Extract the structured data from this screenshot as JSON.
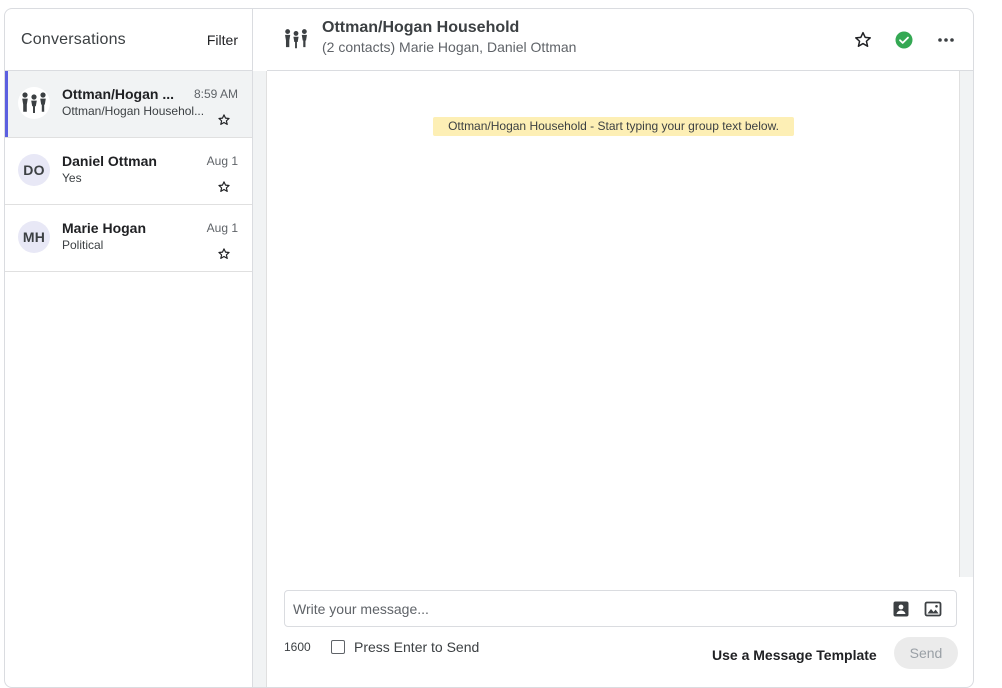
{
  "sidebar": {
    "title": "Conversations",
    "filter_label": "Filter",
    "conversations": [
      {
        "name": "Ottman/Hogan ...",
        "time": "8:59 AM",
        "preview": "Ottman/Hogan Househol...",
        "avatar": "group-icon",
        "active": true
      },
      {
        "name": "Daniel Ottman",
        "time": "Aug 1",
        "preview": "Yes",
        "avatar_initials": "DO"
      },
      {
        "name": "Marie Hogan",
        "time": "Aug 1",
        "preview": "Political",
        "avatar_initials": "MH"
      }
    ]
  },
  "header": {
    "title": "Ottman/Hogan Household",
    "subtitle": "(2 contacts) Marie Hogan, Daniel Ottman",
    "icons": [
      "star-icon",
      "check-circle-icon",
      "more-horizontal-icon"
    ]
  },
  "thread": {
    "banner": "Ottman/Hogan Household - Start typing your group text below."
  },
  "composer": {
    "placeholder": "Write your message...",
    "value": "",
    "char_count": "1600",
    "enter_to_send_label": "Press Enter to Send",
    "enter_to_send_checked": false,
    "template_label": "Use a Message Template",
    "send_label": "Send",
    "icons": [
      "contact-card-icon",
      "image-icon"
    ]
  },
  "colors": {
    "accent": "#5b5fe0",
    "success": "#34a853",
    "banner_bg": "#fdefb5",
    "avatar_bg": "#e8e8f6"
  }
}
